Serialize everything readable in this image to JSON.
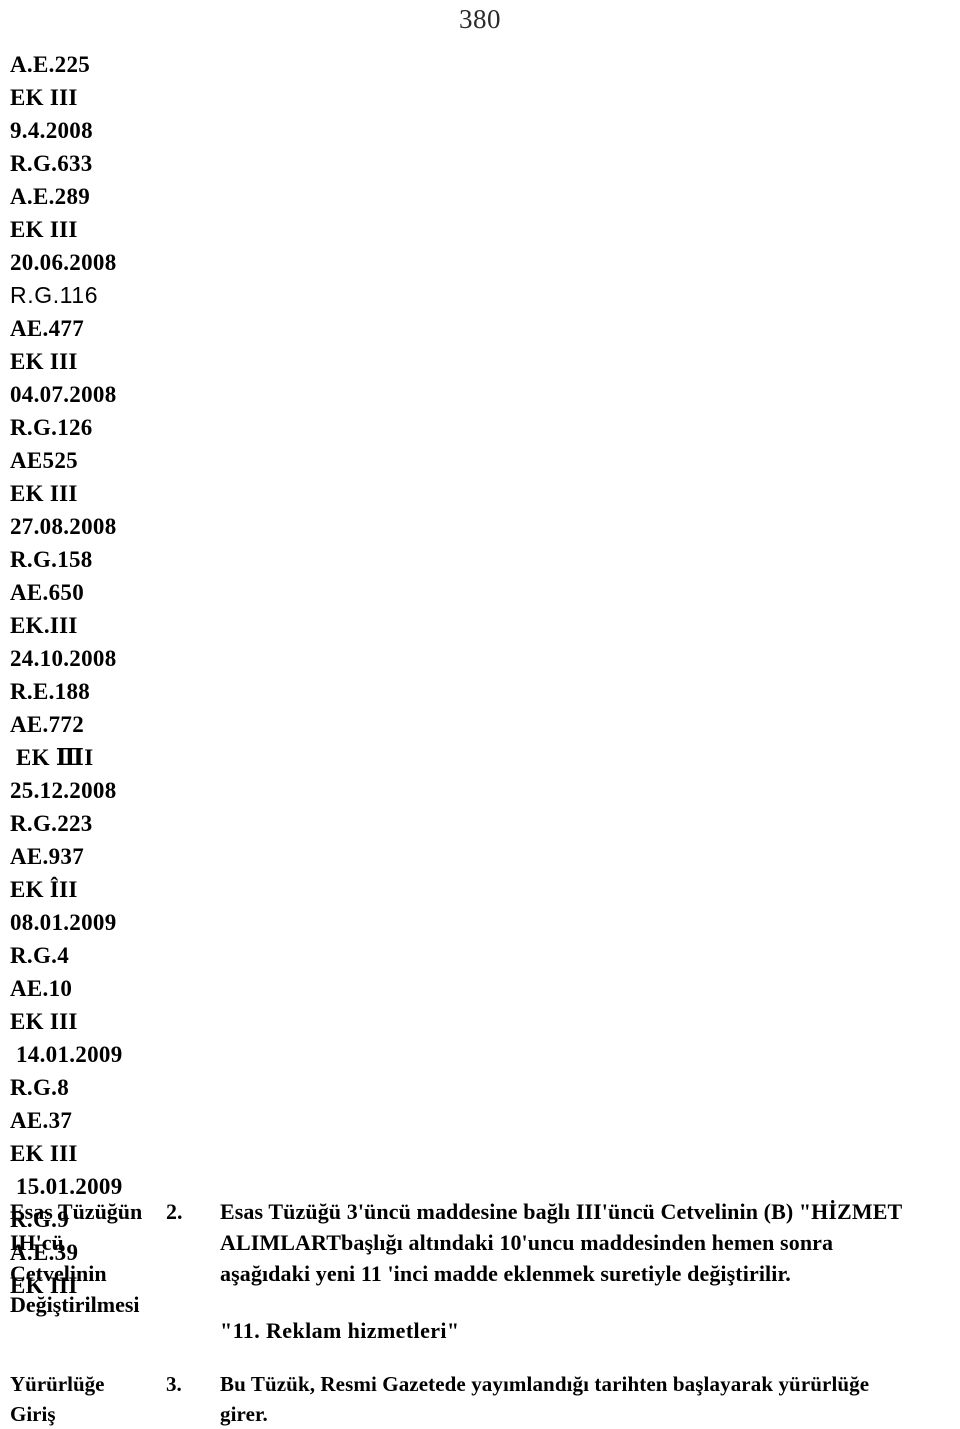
{
  "page": {
    "number": "380"
  },
  "reference_column": {
    "lines": [
      {
        "text": "A.E.225",
        "style": "serif"
      },
      {
        "text": "EK III",
        "style": "serif"
      },
      {
        "text": "9.4.2008",
        "style": "serif"
      },
      {
        "text": "R.G.633",
        "style": "serif"
      },
      {
        "text": "A.E.289",
        "style": "serif"
      },
      {
        "text": "EK III",
        "style": "serif"
      },
      {
        "text": "20.06.2008",
        "style": "serif"
      },
      {
        "text": "R.G.116",
        "style": "sans"
      },
      {
        "text": "AE.477",
        "style": "serif"
      },
      {
        "text": "EK III",
        "style": "serif"
      },
      {
        "text": "04.07.2008",
        "style": "serif"
      },
      {
        "text": "R.G.126",
        "style": "serif"
      },
      {
        "text": "AE525",
        "style": "serif"
      },
      {
        "text": "EK III",
        "style": "serif"
      },
      {
        "text": "27.08.2008",
        "style": "serif"
      },
      {
        "text": "R.G.158",
        "style": "serif"
      },
      {
        "text": "AE.650",
        "style": "serif"
      },
      {
        "text": "EK.III",
        "style": "serif"
      },
      {
        "text": "24.10.2008",
        "style": "serif"
      },
      {
        "text": "R.E.188",
        "style": "serif"
      },
      {
        "text": "AE.772",
        "style": "serif"
      },
      {
        "text": "EK ⅢI",
        "style": "serif-indent"
      },
      {
        "text": "25.12.2008",
        "style": "serif"
      },
      {
        "text": "R.G.223",
        "style": "serif"
      },
      {
        "text": "AE.937",
        "style": "serif"
      },
      {
        "text": "EK ÎII",
        "style": "serif"
      },
      {
        "text": "08.01.2009",
        "style": "serif"
      },
      {
        "text": "R.G.4",
        "style": "serif"
      },
      {
        "text": "AE.10",
        "style": "serif"
      },
      {
        "text": "EK III",
        "style": "serif"
      },
      {
        "text": "14.01.2009",
        "style": "serif-indent"
      },
      {
        "text": "R.G.8",
        "style": "serif"
      },
      {
        "text": "AE.37",
        "style": "serif"
      },
      {
        "text": "EK III",
        "style": "serif"
      },
      {
        "text": "15.01.2009",
        "style": "serif-indent"
      },
      {
        "text": "R.G.9",
        "style": "serif"
      },
      {
        "text": "A.E.39",
        "style": "serif"
      },
      {
        "text": "EK III",
        "style": "serif"
      }
    ]
  },
  "articles": [
    {
      "id": "article-2",
      "label_lines": [
        "Esas Tüzüğün",
        "IH'cü",
        "Cetvelinin",
        "Değiştirilmesi"
      ],
      "number": "2.",
      "body_lines": [
        "Esas Tüzüğü 3'üncü maddesine bağlı III'üncü Cetvelinin (B) \"HİZMET",
        "ALIMLARTbaşlığı altındaki 10'uncu maddesinden hemen sonra",
        "aşağıdaki yeni 11 'inci madde eklenmek suretiyle değiştirilir."
      ],
      "quoted_line": "\"11. Reklam hizmetleri\""
    },
    {
      "id": "article-3",
      "label_lines": [
        "Yürürlüğe",
        "Giriş"
      ],
      "number": "3.",
      "body_lines": [
        "Bu Tüzük, Resmi Gazetede yayımlandığı tarihten  başlayarak yürürlüğe",
        "girer."
      ],
      "quoted_line": ""
    }
  ]
}
